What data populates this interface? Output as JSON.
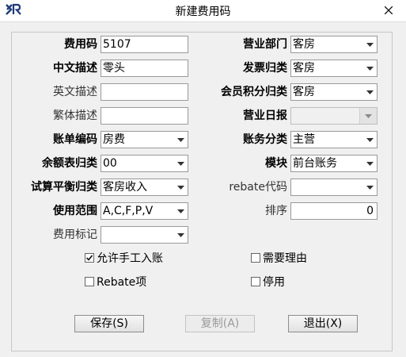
{
  "window": {
    "title": "新建费用码",
    "logo_icon": "xr-logo-icon",
    "close_icon": "close-icon"
  },
  "labels": {
    "fee_code": "费用码",
    "cn_desc": "中文描述",
    "en_desc": "英文描述",
    "tw_desc": "繁体描述",
    "bill_code": "账单编码",
    "balance_cat": "余额表归类",
    "trial_cat": "试算平衡归类",
    "usage_scope": "使用范围",
    "fee_mark": "费用标记",
    "business_dept": "营业部门",
    "invoice_cat": "发票归类",
    "member_cat": "会员积分归类",
    "business_date": "营业日报",
    "account_cat": "账务分类",
    "module": "模块",
    "rebate_code": "rebate代码",
    "sort": "排序"
  },
  "fields": {
    "fee_code": "5107",
    "cn_desc": "零头",
    "en_desc": "",
    "tw_desc": "",
    "bill_code": "房费",
    "balance_cat": "00",
    "trial_cat": "客房收入",
    "usage_scope": "A,C,F,P,V",
    "fee_mark": "",
    "business_dept": "客房",
    "invoice_cat": "客房",
    "member_cat": "客房",
    "business_date": "",
    "account_cat": "主营",
    "module": "前台账务",
    "rebate_code": "",
    "sort": "0"
  },
  "checkboxes": {
    "manual_entry": {
      "label": "允许手工入账",
      "checked": true
    },
    "need_reason": {
      "label": "需要理由",
      "checked": false
    },
    "rebate_item": {
      "label": "Rebate项",
      "checked": false
    },
    "disabled": {
      "label": "停用",
      "checked": false
    }
  },
  "buttons": {
    "save": "保存(S)",
    "copy": "复制(A)",
    "exit": "退出(X)"
  }
}
